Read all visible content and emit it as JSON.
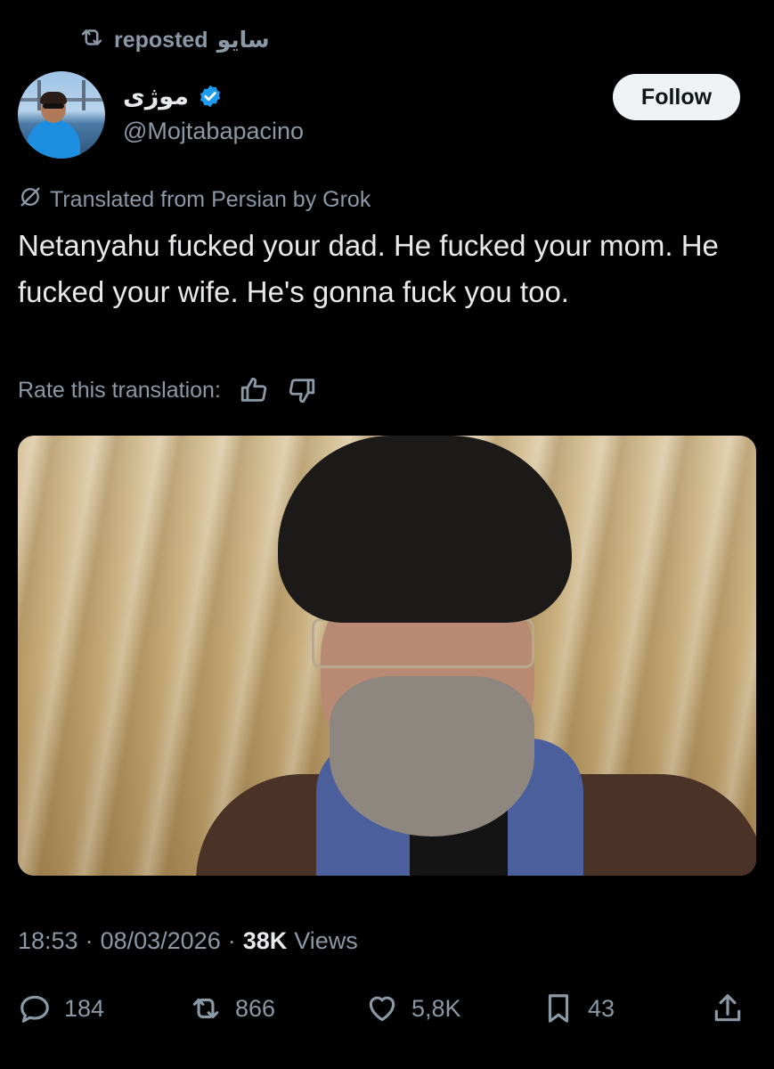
{
  "repost": {
    "label": "reposted",
    "reposter": "سایو"
  },
  "author": {
    "display_name": "موژی",
    "handle": "@Mojtabapacino",
    "verified": true
  },
  "follow_button": {
    "label": "Follow"
  },
  "translation": {
    "note": "Translated from Persian by Grok"
  },
  "tweet": {
    "text": "Netanyahu fucked your dad. He fucked your mom. He fucked your wife. He's gonna fuck you too."
  },
  "rate": {
    "label": "Rate this translation:"
  },
  "meta": {
    "time": "18:53",
    "date": "08/03/2026",
    "separator": "·",
    "views_count": "38K",
    "views_label": "Views"
  },
  "actions": {
    "replies": "184",
    "reposts": "866",
    "likes": "5,8K",
    "bookmarks": "43"
  },
  "colors": {
    "background": "#000000",
    "text": "#e7e9ea",
    "secondary": "#8b98a5",
    "verified": "#1d9bf0",
    "follow_bg": "#eff3f4"
  },
  "icons": {
    "repost": "repost-icon",
    "verified": "verified-badge-icon",
    "translate": "translate-icon",
    "thumbs_up": "thumbs-up-icon",
    "thumbs_down": "thumbs-down-icon",
    "reply": "reply-icon",
    "like": "heart-icon",
    "bookmark": "bookmark-icon",
    "share": "share-icon"
  }
}
